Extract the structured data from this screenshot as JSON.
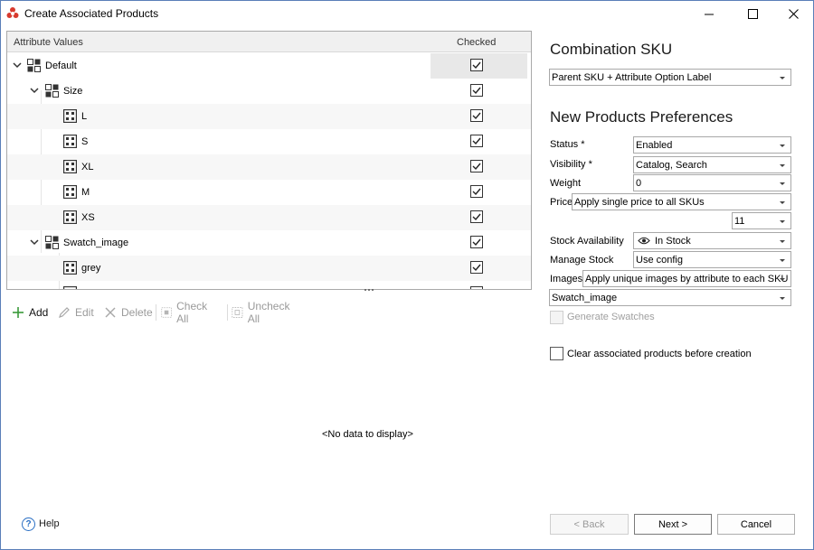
{
  "window": {
    "title": "Create Associated Products",
    "minimize": "—",
    "maximize": "☐",
    "close": "✕"
  },
  "tree": {
    "columns": {
      "attribute": "Attribute Values",
      "checked": "Checked"
    },
    "rows": [
      {
        "label": "Default",
        "level": 0,
        "type": "group",
        "checked": true,
        "expanded": true
      },
      {
        "label": "Size",
        "level": 1,
        "type": "group",
        "checked": true,
        "expanded": true
      },
      {
        "label": "L",
        "level": 2,
        "type": "value",
        "checked": true
      },
      {
        "label": "S",
        "level": 2,
        "type": "value",
        "checked": true
      },
      {
        "label": "XL",
        "level": 2,
        "type": "value",
        "checked": true
      },
      {
        "label": "M",
        "level": 2,
        "type": "value",
        "checked": true
      },
      {
        "label": "XS",
        "level": 2,
        "type": "value",
        "checked": true
      },
      {
        "label": "Swatch_image",
        "level": 1,
        "type": "group",
        "checked": true,
        "expanded": true
      },
      {
        "label": "grey",
        "level": 2,
        "type": "value",
        "checked": true
      }
    ]
  },
  "toolbar": {
    "add": "Add",
    "edit": "Edit",
    "delete": "Delete",
    "check_all": "Check All",
    "uncheck_all": "Uncheck All"
  },
  "empty_grid": "<No data to display>",
  "combination": {
    "title": "Combination SKU",
    "value": "Parent SKU + Attribute Option Label"
  },
  "prefs": {
    "title": "New Products Preferences",
    "status_label": "Status *",
    "status_value": "Enabled",
    "visibility_label": "Visibility *",
    "visibility_value": "Catalog, Search",
    "weight_label": "Weight",
    "weight_value": "0",
    "price_label": "Price",
    "price_value": "Apply single price to all SKUs",
    "price_extra_value": "11",
    "stock_label": "Stock Availability",
    "stock_value": "In Stock",
    "manage_stock_label": "Manage Stock",
    "manage_stock_value": "Use config",
    "images_label": "Images",
    "images_value": "Apply unique images by attribute to each SKU",
    "images_attr_value": "Swatch_image",
    "generate_swatches": "Generate Swatches",
    "clear_associated": "Clear associated products before creation"
  },
  "footer": {
    "help": "Help",
    "back": "< Back",
    "next": "Next >",
    "cancel": "Cancel"
  }
}
